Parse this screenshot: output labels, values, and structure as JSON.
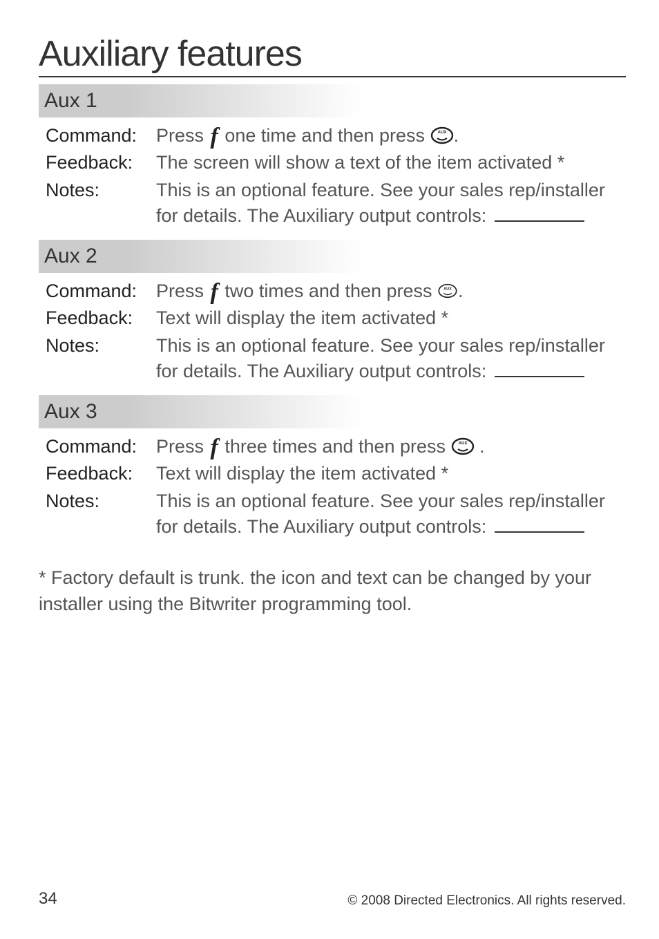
{
  "title": "Auxiliary features",
  "sections": [
    {
      "header": "Aux 1",
      "labels": {
        "command": "Command",
        "feedback": "Feedback",
        "notes": "Notes"
      },
      "command_pre": "Press ",
      "command_mid": " one time and then press ",
      "command_post": ".",
      "feedback": "The screen will show a text of the item activated *",
      "notes1": "This is an optional feature. See your sales rep/installer",
      "notes2": "for details. The Auxiliary output controls: ",
      "aux_variant": "large"
    },
    {
      "header": "Aux 2",
      "labels": {
        "command": "Command",
        "feedback": "Feedback",
        "notes": "Notes"
      },
      "command_pre": "Press ",
      "command_mid": "  two times and then press ",
      "command_post": ".",
      "feedback": "Text will display the item activated *",
      "notes1": "This is an optional feature. See your sales rep/installer",
      "notes2": "for details. The Auxiliary output controls: ",
      "aux_variant": "small"
    },
    {
      "header": "Aux 3",
      "labels": {
        "command": "Command",
        "feedback": "Feedback",
        "notes": "Notes"
      },
      "command_pre": "Press ",
      "command_mid": "  three times and then press ",
      "command_post": " .",
      "feedback": "Text will display the item activated *",
      "notes1": "This is an optional feature. See your sales rep/installer",
      "notes2": "for details. The Auxiliary output controls: ",
      "aux_variant": "large"
    }
  ],
  "footnote": "* Factory default is trunk. the icon and text can be changed by your installer using the Bitwriter programming tool.",
  "footer": {
    "page": "34",
    "copyright": "© 2008 Directed Electronics. All rights reserved."
  }
}
